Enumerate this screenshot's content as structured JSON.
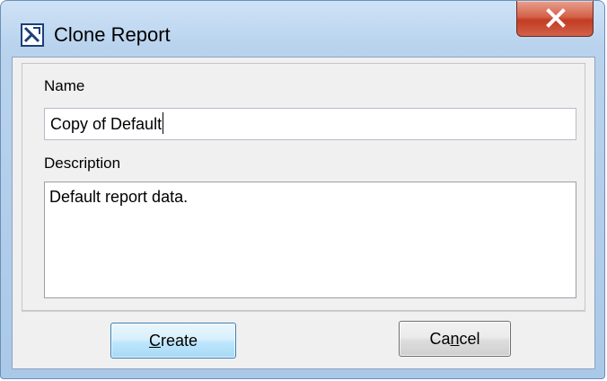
{
  "window": {
    "title": "Clone Report",
    "icon": "report-icon",
    "close_icon": "close-icon",
    "close_color": "#c8432a"
  },
  "form": {
    "name_label": "Name",
    "name_value": "Copy of Default",
    "description_label": "Description",
    "description_value": "Default report data."
  },
  "buttons": {
    "create": {
      "mnemonic": "C",
      "rest": "reate"
    },
    "cancel": {
      "pre": "Ca",
      "mnemonic": "n",
      "post": "cel"
    }
  }
}
